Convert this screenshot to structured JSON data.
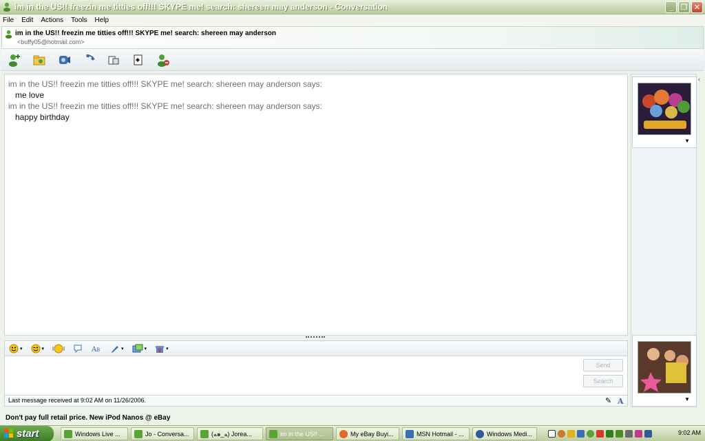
{
  "window": {
    "title": "im in the US!! freezin me titties off!!! SKYPE me! search: shereen may anderson - Conversation"
  },
  "menu": [
    "File",
    "Edit",
    "Actions",
    "Tools",
    "Help"
  ],
  "contact": {
    "name": "im in the US!! freezin me titties off!!! SKYPE me! search: shereen may anderson",
    "email": "<buffy05@hotmail.com>"
  },
  "toolbar": {
    "icons": [
      "invite-contact-icon",
      "send-files-icon",
      "video-call-icon",
      "call-icon",
      "activities-icon",
      "games-icon",
      "block-icon"
    ]
  },
  "conversation": [
    {
      "sender_line": "im in the US!! freezin me titties off!!! SKYPE me! search: shereen may anderson says:",
      "message": "me love"
    },
    {
      "sender_line": "im in the US!! freezin me titties off!!! SKYPE me! search: shereen may anderson says:",
      "message": "happy birthday"
    }
  ],
  "input": {
    "send_label": "Send",
    "search_label": "Search"
  },
  "status": {
    "last_message": "Last message received at 9:02 AM on 11/26/2006."
  },
  "ad": {
    "text": "Don't pay full retail price. New iPod Nanos @ eBay"
  },
  "taskbar": {
    "start_label": "start",
    "tasks": [
      {
        "label": "Windows Live ...",
        "active": false
      },
      {
        "label": "Jo - Conversa...",
        "active": false
      },
      {
        "label": "(ﻪ๑_ﻪ) Jorea...",
        "active": false
      },
      {
        "label": "im in the US!! ...",
        "active": true
      },
      {
        "label": "My eBay Buyi...",
        "active": false
      },
      {
        "label": "MSN Hotmail - ...",
        "active": false
      },
      {
        "label": "Windows Medi...",
        "active": false
      }
    ],
    "clock": "9:02 AM"
  },
  "colors": {
    "title_text": "#ffffff",
    "says_gray": "#707070",
    "taskbar_green": "#3b7a25"
  }
}
